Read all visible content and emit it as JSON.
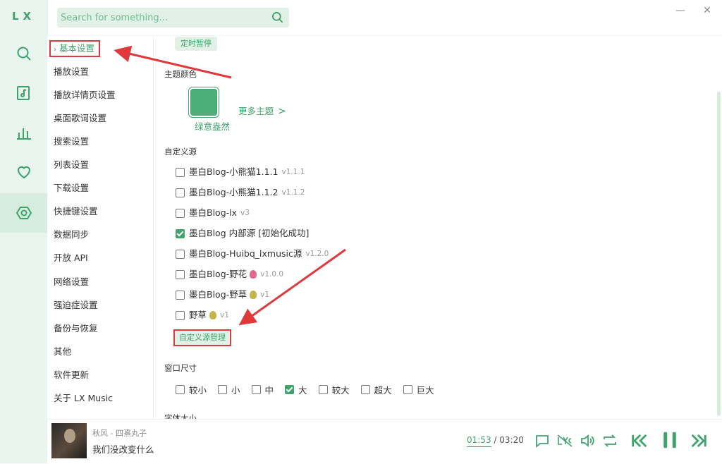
{
  "app": {
    "logo": "LX"
  },
  "search": {
    "placeholder": "Search for something..."
  },
  "window": {
    "minimize": "—",
    "close": "✕"
  },
  "rail": [
    {
      "name": "search-icon"
    },
    {
      "name": "music-note-icon"
    },
    {
      "name": "bar-chart-icon"
    },
    {
      "name": "heart-icon"
    },
    {
      "name": "settings-gear-icon",
      "active": true
    }
  ],
  "settings_nav": [
    "基本设置",
    "播放设置",
    "播放详情页设置",
    "桌面歌词设置",
    "搜索设置",
    "列表设置",
    "下载设置",
    "快捷键设置",
    "数据同步",
    "开放 API",
    "网络设置",
    "强迫症设置",
    "备份与恢复",
    "其他",
    "软件更新",
    "关于 LX Music"
  ],
  "settings_nav_chevron": "›",
  "content": {
    "timer_button": "定时暂停",
    "theme": {
      "title": "主题颜色",
      "name": "绿意盎然",
      "more": "更多主题",
      "swatch_color": "#4caf7a"
    },
    "source": {
      "title": "自定义源",
      "items": [
        {
          "label": "墨白Blog-小熊猫1.1.1",
          "version": "v1.1.1",
          "checked": false
        },
        {
          "label": "墨白Blog-小熊猫1.1.2",
          "version": "v1.1.2",
          "checked": false
        },
        {
          "label": "墨白Blog-lx",
          "version": "v3",
          "checked": false
        },
        {
          "label": "墨白Blog 内部源 [初始化成功]",
          "version": "",
          "checked": true
        },
        {
          "label": "墨白Blog-Huibq_lxmusic源",
          "version": "v1.2.0",
          "checked": false
        },
        {
          "label": "墨白Blog-野花",
          "version": "v1.0.0",
          "checked": false,
          "emoji": "tulip"
        },
        {
          "label": "墨白Blog-野草",
          "version": "v1",
          "checked": false,
          "emoji": "herb"
        },
        {
          "label": "野草",
          "version": "v1",
          "checked": false,
          "emoji": "herb"
        }
      ],
      "manage_button": "自定义源管理"
    },
    "window_size": {
      "title": "窗口尺寸",
      "options": [
        {
          "label": "较小",
          "checked": false
        },
        {
          "label": "小",
          "checked": false
        },
        {
          "label": "中",
          "checked": false
        },
        {
          "label": "大",
          "checked": true
        },
        {
          "label": "较大",
          "checked": false
        },
        {
          "label": "超大",
          "checked": false
        },
        {
          "label": "巨大",
          "checked": false
        }
      ]
    },
    "font_size": {
      "title": "字体大小"
    }
  },
  "player": {
    "artist_line": "秋风 - 四熹丸子",
    "title": "我们没改变什么",
    "current_time": "01:53",
    "separator": "/",
    "total_time": "03:20"
  },
  "colors": {
    "accent": "#3fa36b",
    "annotation": "#e0393b"
  }
}
